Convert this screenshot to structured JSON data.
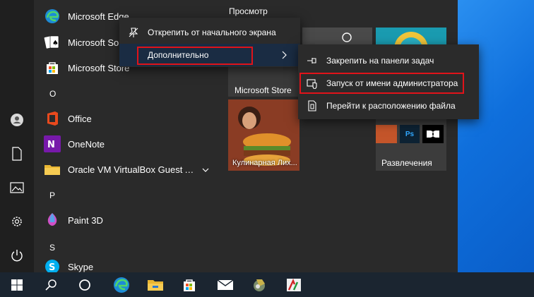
{
  "start_menu": {
    "apps": [
      {
        "name": "Microsoft Edge"
      },
      {
        "name": "Microsoft Solitaire Collection"
      },
      {
        "name": "Microsoft Store"
      },
      {
        "name": "Office"
      },
      {
        "name": "OneNote"
      },
      {
        "name": "Oracle VM VirtualBox Guest Additions"
      },
      {
        "name": "Paint 3D"
      },
      {
        "name": "Skype"
      }
    ],
    "letters": [
      "O",
      "P",
      "S"
    ],
    "tiles_group_title": "Просмотр",
    "tiles": {
      "store_label": "Microsoft Store",
      "cooking_label": "Кулинарная Лих...",
      "entertainment_label": "Развлечения"
    }
  },
  "context_menu": {
    "unpin_label": "Открепить от начального экрана",
    "more_label": "Дополнительно"
  },
  "submenu": {
    "pin_taskbar_label": "Закрепить на панели задач",
    "run_as_admin_label": "Запуск от имени администратора",
    "open_location_label": "Перейти к расположению файла"
  },
  "colors": {
    "highlight_border": "#e0131a",
    "start_bg": "#2a2a2a",
    "taskbar_bg": "#1b2530"
  }
}
